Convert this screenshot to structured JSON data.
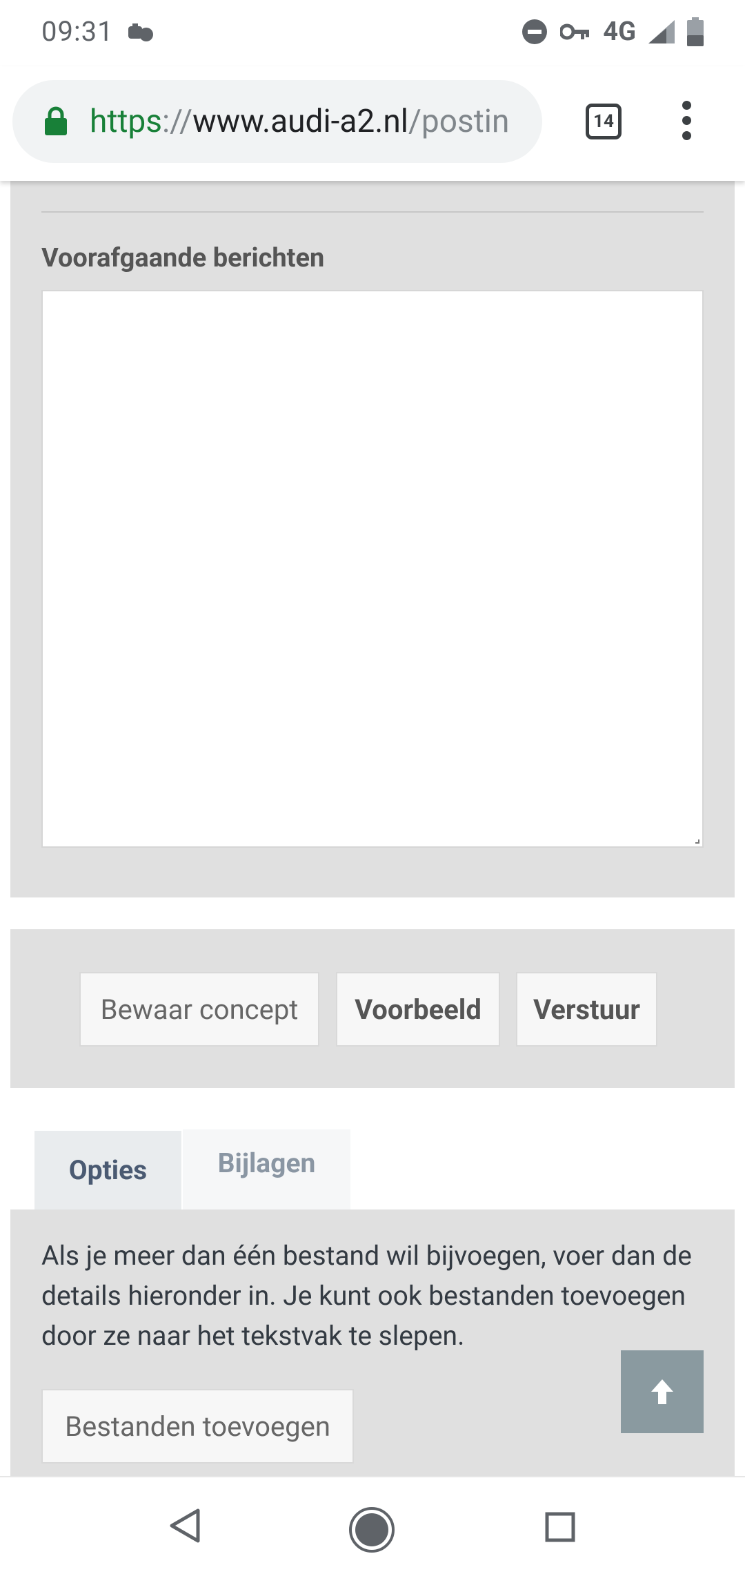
{
  "status_bar": {
    "time": "09:31",
    "network": "4G",
    "icons": [
      "notification-icon",
      "dnd-icon",
      "vpn-key-icon",
      "signal-icon",
      "battery-icon"
    ]
  },
  "browser": {
    "url_scheme": "https",
    "url_separator": "://",
    "url_host": "www.audi-a2.nl",
    "url_path": "/postin",
    "tab_count": "14",
    "colors": {
      "secure": "#188038",
      "omnibox_bg": "#f1f3f4"
    }
  },
  "form": {
    "previous_messages_label": "Voorafgaande berichten",
    "previous_messages_value": "",
    "buttons": {
      "save_draft": "Bewaar concept",
      "preview": "Voorbeeld",
      "submit": "Verstuur"
    },
    "tabs": [
      {
        "label": "Opties",
        "active": true
      },
      {
        "label": "Bijlagen",
        "active": false
      }
    ],
    "attachments_info": "Als je meer dan één bestand wil bijvoegen, voer dan de details hieronder in. Je kunt ook bestanden toevoegen door ze naar het tekstvak te slepen.",
    "add_files_label": "Bestanden toevoegen"
  },
  "colors": {
    "panel_bg": "#e0e0e0",
    "scroll_top_bg": "#8a9aa0",
    "active_tab_text": "#4a5a72"
  }
}
